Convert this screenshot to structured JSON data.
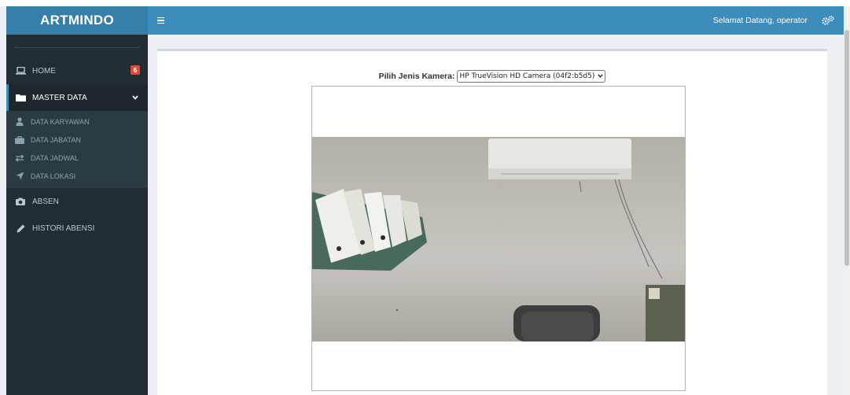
{
  "app": {
    "brand": "ARTMINDO"
  },
  "navbar": {
    "menu_icon": "hamburger-icon",
    "user_greeting": "Selamat Datang, operator",
    "settings_icon": "gears-icon"
  },
  "sidebar": {
    "items": [
      {
        "label": "HOME",
        "icon": "laptop-icon",
        "badge": "6"
      },
      {
        "label": "MASTER DATA",
        "icon": "folder-icon",
        "expanded": true,
        "children": [
          {
            "label": "DATA KARYAWAN",
            "icon": "user-icon"
          },
          {
            "label": "DATA JABATAN",
            "icon": "briefcase-icon"
          },
          {
            "label": "DATA JADWAL",
            "icon": "exchange-icon"
          },
          {
            "label": "DATA LOKASI",
            "icon": "location-arrow-icon"
          }
        ]
      },
      {
        "label": "ABSEN",
        "icon": "camera-icon"
      },
      {
        "label": "HISTORI ABENSI",
        "icon": "pencil-icon"
      }
    ]
  },
  "camera": {
    "label": "Pilih Jenis Kamera:",
    "selected": "HP TrueVision HD Camera (04f2:b5d5)"
  },
  "colors": {
    "navbar": "#3c8dbc",
    "brand": "#367fa9",
    "sidebar": "#222d32",
    "badge": "#dd4b39"
  }
}
